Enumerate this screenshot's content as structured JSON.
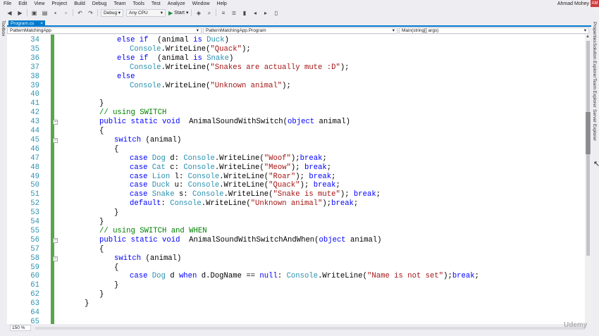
{
  "menu": [
    "File",
    "Edit",
    "View",
    "Project",
    "Build",
    "Debug",
    "Team",
    "Tools",
    "Test",
    "Analyze",
    "Window",
    "Help"
  ],
  "user": {
    "name": "Ahmad Mohey",
    "initials": "AM"
  },
  "toolbar": {
    "config": "Debug",
    "platform": "Any CPU",
    "start_label": "Start"
  },
  "left_strip": "Toolbox",
  "right_strip": [
    "Properties",
    "Solution Explorer",
    "Team Explorer",
    "Server Explorer"
  ],
  "tab": {
    "title": "Program.cs",
    "close": "×"
  },
  "nav": {
    "project": "PatternMatchingApp",
    "type": "PatternMatchingApp.Program",
    "member": "Main(string[] args)"
  },
  "zoom": "150 %",
  "watermark": "Udemy",
  "lines": [
    {
      "n": "34",
      "fold": false,
      "tokens": [
        [
          "k",
          "else if"
        ],
        [
          "",
          "  (animal "
        ],
        [
          "k",
          "is"
        ],
        [
          "",
          ""
        ],
        [
          "t",
          " Duck"
        ],
        [
          "",
          ")"
        ]
      ]
    },
    {
      "n": "35",
      "fold": false,
      "tokens": [
        [
          "t",
          "Console"
        ],
        [
          "",
          ".WriteLine("
        ],
        [
          "s",
          "\"Quack\""
        ],
        [
          "",
          ");"
        ]
      ]
    },
    {
      "n": "36",
      "fold": false,
      "tokens": [
        [
          "k",
          "else if"
        ],
        [
          "",
          "  (animal "
        ],
        [
          "k",
          "is"
        ],
        [
          "t",
          " Snake"
        ],
        [
          "",
          ")"
        ]
      ]
    },
    {
      "n": "37",
      "fold": false,
      "tokens": [
        [
          "t",
          "Console"
        ],
        [
          "",
          ".WriteLine("
        ],
        [
          "s",
          "\"Snakes are actually mute :D\""
        ],
        [
          "",
          ");"
        ]
      ]
    },
    {
      "n": "38",
      "fold": false,
      "tokens": [
        [
          "k",
          "else"
        ]
      ]
    },
    {
      "n": "39",
      "fold": false,
      "tokens": [
        [
          "t",
          "Console"
        ],
        [
          "",
          ".WriteLine("
        ],
        [
          "s",
          "\"Unknown animal\""
        ],
        [
          "",
          ");"
        ]
      ]
    },
    {
      "n": "40",
      "fold": false,
      "tokens": []
    },
    {
      "n": "41",
      "fold": false,
      "tokens": [
        [
          "",
          "}"
        ]
      ]
    },
    {
      "n": "42",
      "fold": false,
      "tokens": [
        [
          "c",
          "// using SWITCH"
        ]
      ]
    },
    {
      "n": "43",
      "fold": true,
      "tokens": [
        [
          "k",
          "public static void"
        ],
        [
          "",
          ""
        ],
        [
          "",
          "  AnimalSoundWithSwitch("
        ],
        [
          "k",
          "object"
        ],
        [
          "",
          " animal)"
        ]
      ]
    },
    {
      "n": "44",
      "fold": false,
      "tokens": [
        [
          "",
          "{"
        ]
      ]
    },
    {
      "n": "45",
      "fold": true,
      "tokens": [
        [
          "k",
          "switch"
        ],
        [
          "",
          " (animal)"
        ]
      ]
    },
    {
      "n": "46",
      "fold": false,
      "tokens": [
        [
          "",
          "{"
        ]
      ]
    },
    {
      "n": "47",
      "fold": false,
      "tokens": [
        [
          "k",
          "case"
        ],
        [
          "t",
          " Dog"
        ],
        [
          "",
          " d: "
        ],
        [
          "t",
          "Console"
        ],
        [
          "",
          ".WriteLine("
        ],
        [
          "s",
          "\"Woof\""
        ],
        [
          "",
          ");"
        ],
        [
          "k",
          "break"
        ],
        [
          "",
          ";"
        ]
      ]
    },
    {
      "n": "48",
      "fold": false,
      "tokens": [
        [
          "k",
          "case"
        ],
        [
          "t",
          " Cat"
        ],
        [
          "",
          " c: "
        ],
        [
          "t",
          "Console"
        ],
        [
          "",
          ".WriteLine("
        ],
        [
          "s",
          "\"Meow\""
        ],
        [
          "",
          "); "
        ],
        [
          "k",
          "break"
        ],
        [
          "",
          ";"
        ]
      ]
    },
    {
      "n": "49",
      "fold": false,
      "tokens": [
        [
          "k",
          "case"
        ],
        [
          "t",
          " Lion"
        ],
        [
          "",
          " l: "
        ],
        [
          "t",
          "Console"
        ],
        [
          "",
          ".WriteLine("
        ],
        [
          "s",
          "\"Roar\""
        ],
        [
          "",
          "); "
        ],
        [
          "k",
          "break"
        ],
        [
          "",
          ";"
        ]
      ]
    },
    {
      "n": "50",
      "fold": false,
      "tokens": [
        [
          "k",
          "case"
        ],
        [
          "t",
          " Duck"
        ],
        [
          "",
          " u: "
        ],
        [
          "t",
          "Console"
        ],
        [
          "",
          ".WriteLine("
        ],
        [
          "s",
          "\"Quack\""
        ],
        [
          "",
          "); "
        ],
        [
          "k",
          "break"
        ],
        [
          "",
          ";"
        ]
      ]
    },
    {
      "n": "51",
      "fold": false,
      "tokens": [
        [
          "k",
          "case"
        ],
        [
          "t",
          " Snake"
        ],
        [
          "",
          " s: "
        ],
        [
          "t",
          "Console"
        ],
        [
          "",
          ".WriteLine("
        ],
        [
          "s",
          "\"Snake is mute\""
        ],
        [
          "",
          "); "
        ],
        [
          "k",
          "break"
        ],
        [
          "",
          ";"
        ]
      ]
    },
    {
      "n": "52",
      "fold": false,
      "tokens": [
        [
          "k",
          "default"
        ],
        [
          "",
          ": "
        ],
        [
          "t",
          "Console"
        ],
        [
          "",
          ".WriteLine("
        ],
        [
          "s",
          "\"Unknown animal\""
        ],
        [
          "",
          ");"
        ],
        [
          "k",
          "break"
        ],
        [
          "",
          ";"
        ]
      ]
    },
    {
      "n": "53",
      "fold": false,
      "tokens": [
        [
          "",
          "}"
        ]
      ]
    },
    {
      "n": "54",
      "fold": false,
      "tokens": [
        [
          "",
          "}"
        ]
      ]
    },
    {
      "n": "55",
      "fold": false,
      "tokens": [
        [
          "c",
          "// using SWITCH and WHEN"
        ]
      ]
    },
    {
      "n": "56",
      "fold": true,
      "tokens": [
        [
          "k",
          "public static void"
        ],
        [
          "",
          ""
        ],
        [
          "",
          "  AnimalSoundWithSwitchAndWhen("
        ],
        [
          "k",
          "object"
        ],
        [
          "",
          " animal)"
        ]
      ]
    },
    {
      "n": "57",
      "fold": false,
      "tokens": [
        [
          "",
          "{"
        ]
      ]
    },
    {
      "n": "58",
      "fold": true,
      "tokens": [
        [
          "k",
          "switch"
        ],
        [
          "",
          " (animal)"
        ]
      ]
    },
    {
      "n": "59",
      "fold": false,
      "tokens": [
        [
          "",
          "{"
        ]
      ]
    },
    {
      "n": "60",
      "fold": false,
      "tokens": [
        [
          "k",
          "case"
        ],
        [
          "t",
          " Dog"
        ],
        [
          "",
          " d "
        ],
        [
          "k",
          "when"
        ],
        [
          "",
          " d.DogName == "
        ],
        [
          "k",
          "null"
        ],
        [
          "",
          ": "
        ],
        [
          "t",
          "Console"
        ],
        [
          "",
          ".WriteLine("
        ],
        [
          "s",
          "\"Name is not set\""
        ],
        [
          "",
          ");"
        ],
        [
          "k",
          "break"
        ],
        [
          "",
          ";"
        ]
      ]
    },
    {
      "n": "61",
      "fold": false,
      "tokens": [
        [
          "",
          "}"
        ]
      ]
    },
    {
      "n": "62",
      "fold": false,
      "tokens": [
        [
          "",
          "}"
        ]
      ]
    },
    {
      "n": "63",
      "fold": false,
      "tokens": [
        [
          "",
          "}"
        ]
      ]
    },
    {
      "n": "64",
      "fold": false,
      "tokens": []
    },
    {
      "n": "65",
      "fold": false,
      "tokens": []
    }
  ]
}
